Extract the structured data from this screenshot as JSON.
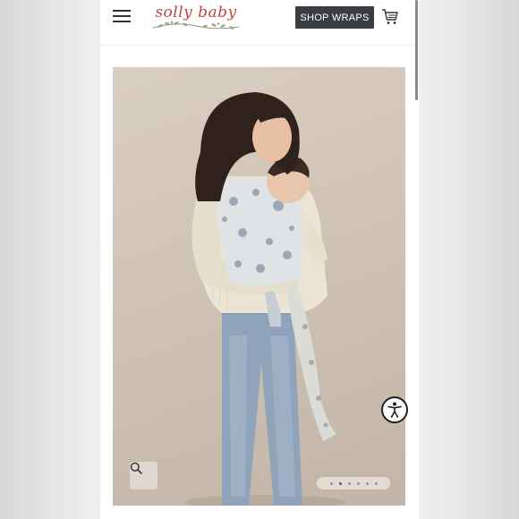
{
  "header": {
    "logo_text": "solly baby",
    "shop_button_label": "SHOP WRAPS",
    "menu_icon": "hamburger-menu-icon",
    "cart_icon": "shopping-cart-icon"
  },
  "gallery": {
    "image_alt": "Mother wearing a baby in a floral print wrap carrier",
    "zoom_icon": "magnifier-icon",
    "slide_count": 6,
    "active_slide": 2
  },
  "accessibility": {
    "icon": "accessibility-icon"
  },
  "colors": {
    "brand": "#c0453e",
    "button_bg": "#3a3d42"
  }
}
